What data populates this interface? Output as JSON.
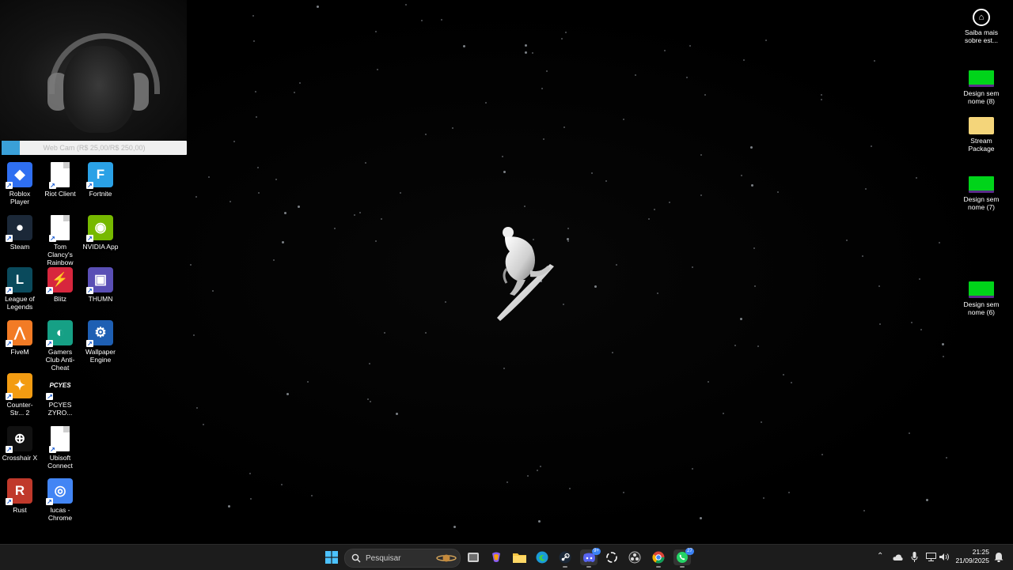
{
  "webcam": {
    "bar_label": "Web Cam (R$ 25,00/R$ 250,00)",
    "progress_percent": 10
  },
  "left_icons": [
    {
      "id": "roblox",
      "label": "Roblox Player",
      "color": "#2f6ff1",
      "glyph": "◆",
      "icon": "roblox-icon"
    },
    {
      "id": "riot",
      "label": "Riot Client",
      "color": "#ffffff",
      "glyph": "",
      "icon": "document-icon"
    },
    {
      "id": "fortnite",
      "label": "Fortnite",
      "color": "#2aa1e6",
      "glyph": "F",
      "icon": "fortnite-icon"
    },
    {
      "id": "steam",
      "label": "Steam",
      "color": "#1b2838",
      "glyph": "●",
      "icon": "steam-icon"
    },
    {
      "id": "rainbow",
      "label": "Tom Clancy's Rainbow Si...",
      "color": "#ffffff",
      "glyph": "",
      "icon": "document-icon"
    },
    {
      "id": "nvidia",
      "label": "NVIDIA App",
      "color": "#76b900",
      "glyph": "◉",
      "icon": "nvidia-icon"
    },
    {
      "id": "lol",
      "label": "League of Legends",
      "color": "#0a4a5c",
      "glyph": "L",
      "icon": "league-icon"
    },
    {
      "id": "blitz",
      "label": "Blitz",
      "color": "#d7263d",
      "glyph": "⚡",
      "icon": "blitz-icon"
    },
    {
      "id": "thumn",
      "label": "THUMN",
      "color": "#5a4fb5",
      "glyph": "▣",
      "icon": "image-icon"
    },
    {
      "id": "fivem",
      "label": "FiveM",
      "color": "#f27b25",
      "glyph": "⋀",
      "icon": "fivem-icon"
    },
    {
      "id": "gamersclub",
      "label": "Gamers Club Anti-Cheat",
      "color": "#16a085",
      "glyph": "◐",
      "icon": "gamersclub-icon"
    },
    {
      "id": "wallpaper",
      "label": "Wallpaper Engine",
      "color": "#1e5fb3",
      "glyph": "⚙",
      "icon": "wallpaper-engine-icon"
    },
    {
      "id": "cs2",
      "label": "Counter-Str... 2",
      "color": "#f39c12",
      "glyph": "✦",
      "icon": "counter-strike-icon"
    },
    {
      "id": "pcyes",
      "label": "PCYES ZYRO...",
      "color": "#000000",
      "glyph": "PCYES",
      "icon": "pcyes-icon"
    },
    {
      "id": "crosshair",
      "label": "Crosshair X",
      "color": "#111111",
      "glyph": "⊕",
      "icon": "crosshair-icon"
    },
    {
      "id": "ubisoft",
      "label": "Ubisoft Connect",
      "color": "#ffffff",
      "glyph": "",
      "icon": "document-icon"
    },
    {
      "id": "rust",
      "label": "Rust",
      "color": "#c0392b",
      "glyph": "R",
      "icon": "rust-icon"
    },
    {
      "id": "chrome",
      "label": "lucas - Chrome",
      "color": "#4285f4",
      "glyph": "◎",
      "icon": "chrome-icon"
    }
  ],
  "right_icons": [
    {
      "id": "saiba",
      "label": "Saiba mais sobre est...",
      "icon": "info-icon",
      "color": "#000000"
    },
    {
      "id": "design8",
      "label": "Design sem nome (8)",
      "icon": "image-icon",
      "color": "#00d41a"
    },
    {
      "id": "stream",
      "label": "Stream Package",
      "icon": "folder-icon",
      "color": "#f4d57a"
    },
    {
      "id": "design7",
      "label": "Design sem nome (7)",
      "icon": "image-icon",
      "color": "#00d41a"
    },
    {
      "id": "design6",
      "label": "Design sem nome (6)",
      "icon": "image-icon",
      "color": "#00d41a"
    }
  ],
  "taskbar": {
    "search_placeholder": "Pesquisar",
    "discord_badge": "9+",
    "whatsapp_badge": "27",
    "time": "21:25",
    "date": "21/09/2025"
  }
}
